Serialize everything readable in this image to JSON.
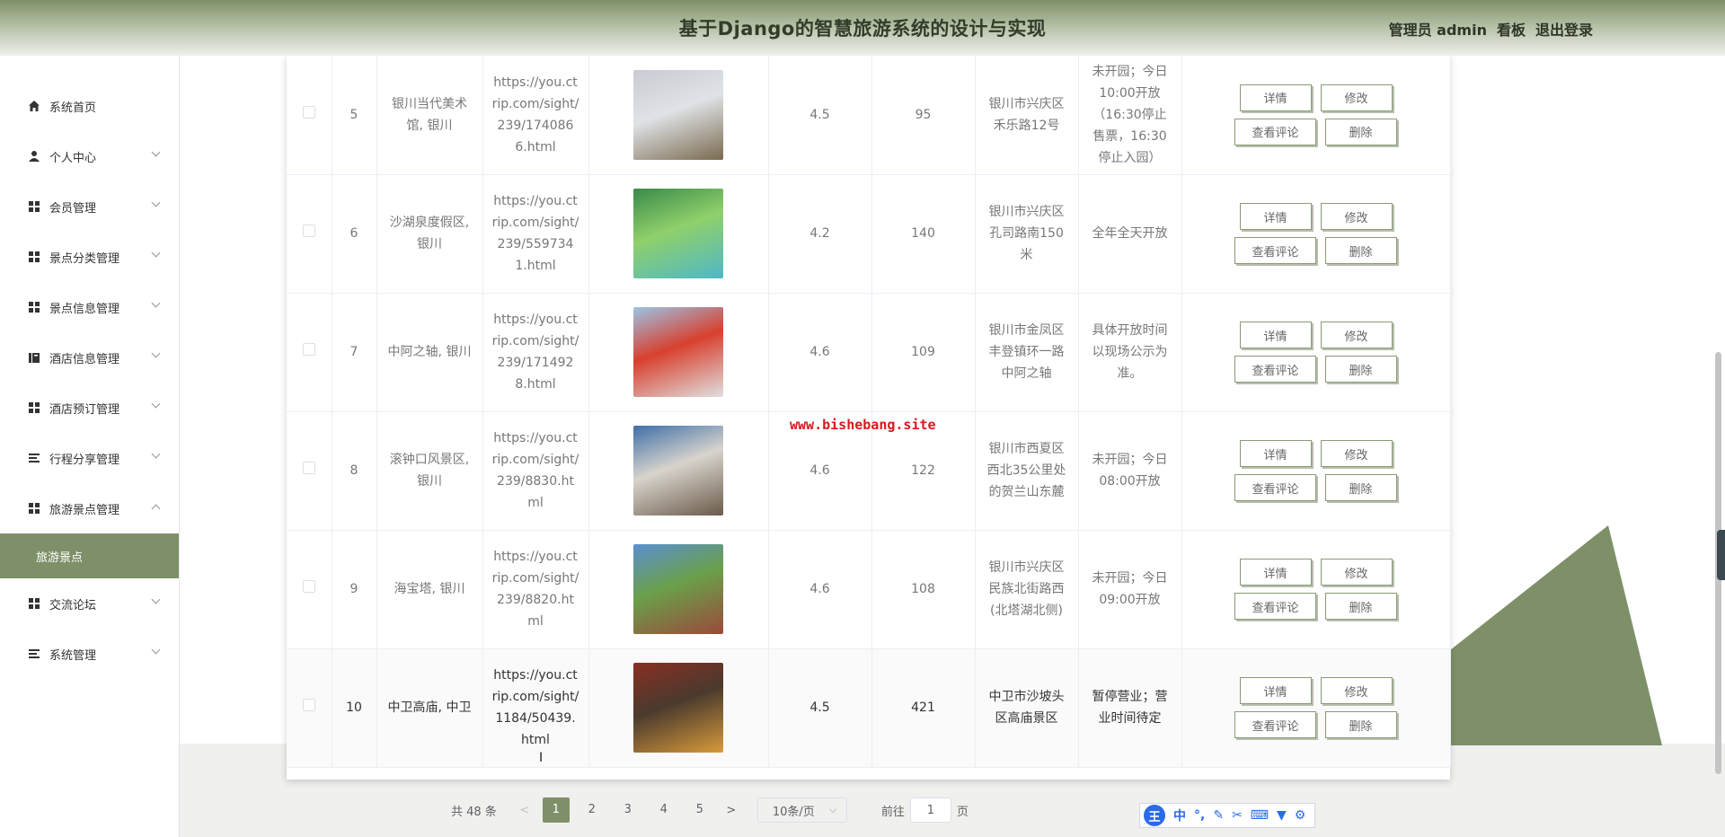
{
  "header": {
    "title": "基于Django的智慧旅游系统的设计与实现",
    "admin_label": "管理员 admin",
    "dashboard_link": "看板",
    "logout_link": "退出登录"
  },
  "sidebar": {
    "items": [
      {
        "label": "系统首页",
        "icon": "home-icon"
      },
      {
        "label": "个人中心",
        "icon": "user-icon"
      },
      {
        "label": "会员管理",
        "icon": "grid-icon"
      },
      {
        "label": "景点分类管理",
        "icon": "grid-icon"
      },
      {
        "label": "景点信息管理",
        "icon": "grid-icon"
      },
      {
        "label": "酒店信息管理",
        "icon": "book-icon"
      },
      {
        "label": "酒店预订管理",
        "icon": "grid-icon"
      },
      {
        "label": "行程分享管理",
        "icon": "list-icon"
      },
      {
        "label": "旅游景点管理",
        "icon": "grid-icon"
      },
      {
        "label": "交流论坛",
        "icon": "grid-icon"
      },
      {
        "label": "系统管理",
        "icon": "list-icon"
      }
    ],
    "active_sub": "旅游景点"
  },
  "table": {
    "rows": [
      {
        "no": "5",
        "name": "银川当代美术馆, 银川",
        "url": "https://you.ctrip.com/sight/239/1740866.html",
        "rating": "4.5",
        "count": "95",
        "address": "银川市兴庆区禾乐路12号",
        "hours": "未开园；今日10:00开放（16:30停止售票，16:30停止入园）",
        "img_colors": [
          "#c8ccd2",
          "#7a6a4f",
          "#dfe2e6"
        ]
      },
      {
        "no": "6",
        "name": "沙湖泉度假区, 银川",
        "url": "https://you.ctrip.com/sight/239/5597341.html",
        "rating": "4.2",
        "count": "140",
        "address": "银川市兴庆区孔司路南150米",
        "hours": "全年全天开放",
        "img_colors": [
          "#3a8a4a",
          "#4fb8c8",
          "#8fd06a"
        ]
      },
      {
        "no": "7",
        "name": "中阿之轴, 银川",
        "url": "https://you.ctrip.com/sight/239/1714928.html",
        "rating": "4.6",
        "count": "109",
        "address": "银川市金凤区丰登镇环一路中阿之轴",
        "hours": "具体开放时间以现场公示为准。",
        "img_colors": [
          "#9cc4e6",
          "#e0e0e0",
          "#d8402e"
        ]
      },
      {
        "no": "8",
        "name": "滚钟口风景区, 银川",
        "url": "https://you.ctrip.com/sight/239/8830.html",
        "rating": "4.6",
        "count": "122",
        "address": "银川市西夏区西北35公里处的贺兰山东麓",
        "hours": "未开园；今日08:00开放",
        "img_colors": [
          "#3f6fa8",
          "#6a5a4a",
          "#d8d4cc"
        ]
      },
      {
        "no": "9",
        "name": "海宝塔, 银川",
        "url": "https://you.ctrip.com/sight/239/8820.html",
        "rating": "4.6",
        "count": "108",
        "address": "银川市兴庆区民族北街路西(北塔湖北侧)",
        "hours": "未开园；今日09:00开放",
        "img_colors": [
          "#5a8fd0",
          "#9a4a3a",
          "#6aa04a"
        ]
      },
      {
        "no": "10",
        "name": "中卫高庙, 中卫",
        "url": "https://you.ctrip.com/sight/1184/50439.html",
        "rating": "4.5",
        "count": "421",
        "address": "中卫市沙坡头区高庙景区",
        "hours": "暂停营业；营业时间待定",
        "img_colors": [
          "#8a2e22",
          "#d89a3a",
          "#4a3a2e"
        ]
      }
    ],
    "buttons": {
      "detail": "详情",
      "edit": "修改",
      "comments": "查看评论",
      "delete": "删除"
    }
  },
  "watermark": "www.bishebang.site",
  "pagination": {
    "total": "共 48 条",
    "prev": "<",
    "next": ">",
    "pages": [
      "1",
      "2",
      "3",
      "4",
      "5"
    ],
    "current": "1",
    "page_size": "10条/页",
    "goto_label": "前往",
    "goto_value": "1",
    "page_suffix": "页"
  },
  "ime": {
    "logo": "王",
    "mode": "中",
    "punct": "°,"
  },
  "colors": {
    "accent": "#7e9068",
    "watermark": "#d9181e",
    "ime_blue": "#2a6be8"
  }
}
